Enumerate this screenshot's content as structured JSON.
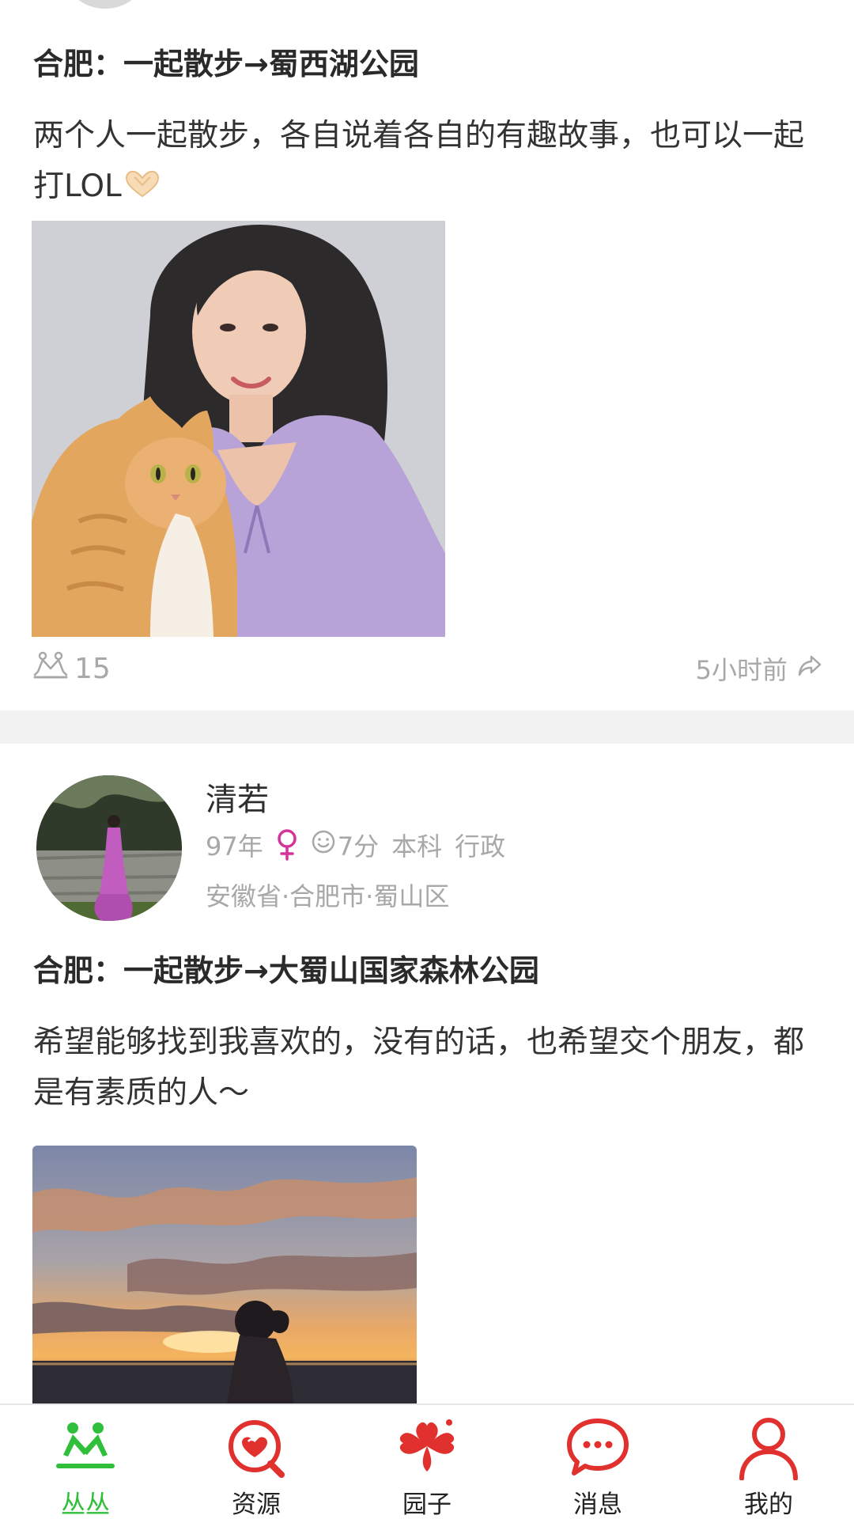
{
  "colors": {
    "accent_green": "#2fbf3a",
    "brand_red": "#e0312f",
    "gender_pink": "#d6339a",
    "meta_gray": "#a8a8a8",
    "divider_gray": "#f2f2f2"
  },
  "posts": [
    {
      "title": "合肥：一起散步→蜀西湖公园",
      "body": "两个人一起散步，各自说着各自的有趣故事，也可以一起打LOL",
      "body_emoji_icon": "heart-hands-icon",
      "image_desc_icon": "photo",
      "partner_count": "15",
      "time": "5小时前"
    },
    {
      "user": {
        "name": "清若",
        "birth_year": "97年",
        "gender": "female",
        "score": "7分",
        "education": "本科",
        "job": "行政",
        "location": "安徽省·合肥市·蜀山区"
      },
      "title": "合肥：一起散步→大蜀山国家森林公园",
      "body": "希望能够找到我喜欢的，没有的话，也希望交个朋友，都是有素质的人～"
    }
  ],
  "tabbar": {
    "items": [
      {
        "label": "丛丛",
        "icon": "congcong-icon",
        "active": true
      },
      {
        "label": "资源",
        "icon": "resource-heart-search-icon",
        "active": false
      },
      {
        "label": "园子",
        "icon": "clover-icon",
        "active": false
      },
      {
        "label": "消息",
        "icon": "message-bubble-icon",
        "active": false
      },
      {
        "label": "我的",
        "icon": "user-icon",
        "active": false
      }
    ]
  }
}
